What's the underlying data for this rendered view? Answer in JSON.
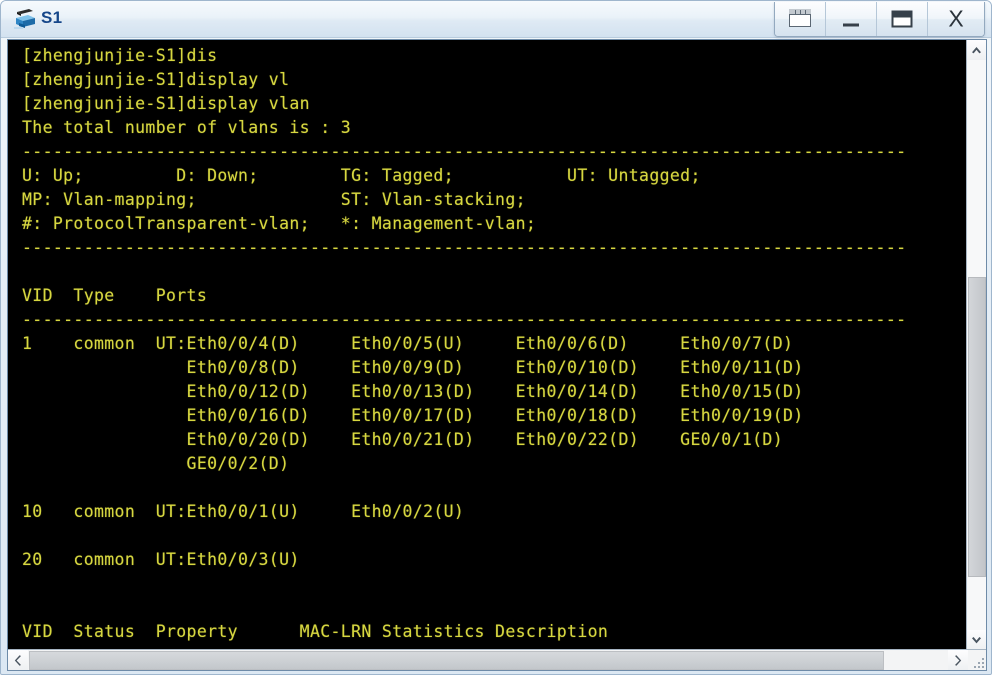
{
  "window": {
    "title": "S1",
    "icon": "switch-icon",
    "controls": [
      {
        "name": "cascade-button",
        "label": "Cascade"
      },
      {
        "name": "minimize-button",
        "label": "Minimize"
      },
      {
        "name": "maximize-button",
        "label": "Maximize"
      },
      {
        "name": "close-button",
        "label": "X"
      }
    ]
  },
  "theme": {
    "terminal_bg": "#000000",
    "terminal_fg": "#d7d740",
    "titlebar_text": "#16478a",
    "frame_border": "#6e8ba8"
  },
  "terminal": {
    "prompt": "[zhengjunjie-S1]",
    "commands": [
      "dis",
      "display vl",
      "display vlan"
    ],
    "summary_line": "The total number of vlans is : 3",
    "separator": "--------------------------------------------------------------------------------------",
    "legend": [
      "U: Up;          D: Down;         TG: Tagged;            UT: Untagged;",
      "MP: Vlan-mapping;                ST: Vlan-stacking;",
      "#: ProtocolTransparent-vlan;     *: Management-vlan;"
    ],
    "table_headers_1": "VID  Type    Ports",
    "table_headers_2": "VID  Status  Property      MAC-LRN Statistics Description",
    "vlans": [
      {
        "vid": "1",
        "type": "common",
        "tag": "UT:",
        "port_rows": [
          [
            "Eth0/0/4(D)",
            "Eth0/0/5(U)",
            "Eth0/0/6(D)",
            "Eth0/0/7(D)"
          ],
          [
            "Eth0/0/8(D)",
            "Eth0/0/9(D)",
            "Eth0/0/10(D)",
            "Eth0/0/11(D)"
          ],
          [
            "Eth0/0/12(D)",
            "Eth0/0/13(D)",
            "Eth0/0/14(D)",
            "Eth0/0/15(D)"
          ],
          [
            "Eth0/0/16(D)",
            "Eth0/0/17(D)",
            "Eth0/0/18(D)",
            "Eth0/0/19(D)"
          ],
          [
            "Eth0/0/20(D)",
            "Eth0/0/21(D)",
            "Eth0/0/22(D)",
            "GE0/0/1(D)"
          ],
          [
            "GE0/0/2(D)"
          ]
        ]
      },
      {
        "vid": "10",
        "type": "common",
        "tag": "UT:",
        "port_rows": [
          [
            "Eth0/0/1(U)",
            "Eth0/0/2(U)"
          ]
        ]
      },
      {
        "vid": "20",
        "type": "common",
        "tag": "UT:",
        "port_rows": [
          [
            "Eth0/0/3(U)"
          ]
        ]
      }
    ],
    "screen_text": "[zhengjunjie-S1]dis\n[zhengjunjie-S1]display vl\n[zhengjunjie-S1]display vlan\nThe total number of vlans is : 3\n--------------------------------------------------------------------------------------\nU: Up;         D: Down;        TG: Tagged;           UT: Untagged;\nMP: Vlan-mapping;              ST: Vlan-stacking;\n#: ProtocolTransparent-vlan;   *: Management-vlan;\n--------------------------------------------------------------------------------------\n\nVID  Type    Ports\n--------------------------------------------------------------------------------------\n1    common  UT:Eth0/0/4(D)     Eth0/0/5(U)     Eth0/0/6(D)     Eth0/0/7(D)\n                Eth0/0/8(D)     Eth0/0/9(D)     Eth0/0/10(D)    Eth0/0/11(D)\n                Eth0/0/12(D)    Eth0/0/13(D)    Eth0/0/14(D)    Eth0/0/15(D)\n                Eth0/0/16(D)    Eth0/0/17(D)    Eth0/0/18(D)    Eth0/0/19(D)\n                Eth0/0/20(D)    Eth0/0/21(D)    Eth0/0/22(D)    GE0/0/1(D)\n                GE0/0/2(D)\n\n10   common  UT:Eth0/0/1(U)     Eth0/0/2(U)\n\n20   common  UT:Eth0/0/3(U)\n\n\nVID  Status  Property      MAC-LRN Statistics Description"
  },
  "scrollbars": {
    "vertical": {
      "up_arrow": "chevron-up-icon",
      "down_arrow": "chevron-down-icon"
    },
    "horizontal": {
      "left_arrow": "chevron-left-icon",
      "right_arrow": "chevron-right-icon"
    }
  }
}
